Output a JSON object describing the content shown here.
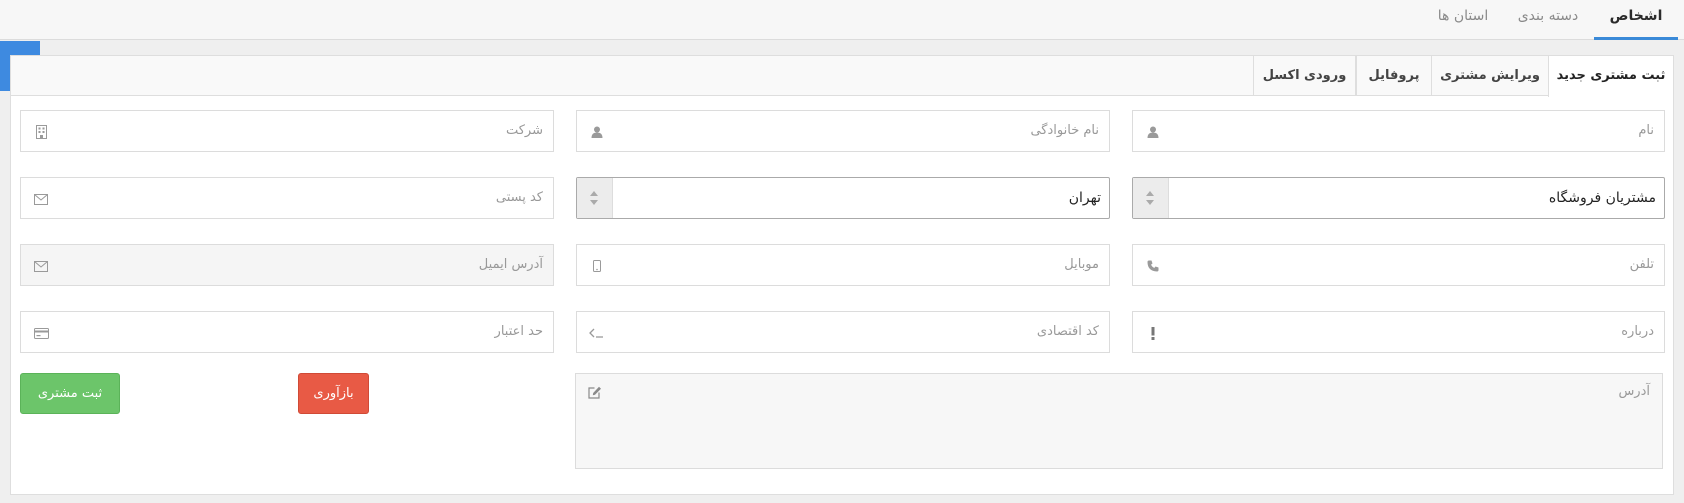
{
  "top_tabs": {
    "people": "اشخاص",
    "categories": "دسته بندی",
    "provinces": "استان ها"
  },
  "form_tabs": {
    "new_customer": "ثبت مشتری جدید",
    "edit_customer": "ویرایش مشتری",
    "profile": "پروفایل",
    "excel_import": "ورودی اکسل"
  },
  "fields": {
    "first_name": {
      "placeholder": "نام",
      "icon": "user-icon"
    },
    "last_name": {
      "placeholder": "نام خانوادگی",
      "icon": "user-icon"
    },
    "company": {
      "placeholder": "شرکت",
      "icon": "building-icon"
    },
    "customer_group": {
      "value": "مشتریان فروشگاه"
    },
    "province": {
      "value": "تهران"
    },
    "postal_code": {
      "placeholder": "کد پستی",
      "icon": "envelope-icon"
    },
    "phone": {
      "placeholder": "تلفن",
      "icon": "phone-icon"
    },
    "mobile": {
      "placeholder": "موبایل",
      "icon": "mobile-icon"
    },
    "email": {
      "placeholder": "آدرس ایمیل",
      "icon": "envelope-icon"
    },
    "about": {
      "placeholder": "درباره",
      "icon": "exclamation-icon"
    },
    "economic_code": {
      "placeholder": "کد اقتصادی",
      "icon": "terminal-icon"
    },
    "credit_limit": {
      "placeholder": "حد اعتبار",
      "icon": "credit-card-icon"
    },
    "address": {
      "placeholder": "آدرس",
      "icon": "edit-icon"
    }
  },
  "buttons": {
    "reset": "بازآوری",
    "submit": "ثبت مشتری"
  },
  "colors": {
    "accent": "#3e8ae0",
    "reset": "#e85a45",
    "submit": "#6cc56a"
  }
}
